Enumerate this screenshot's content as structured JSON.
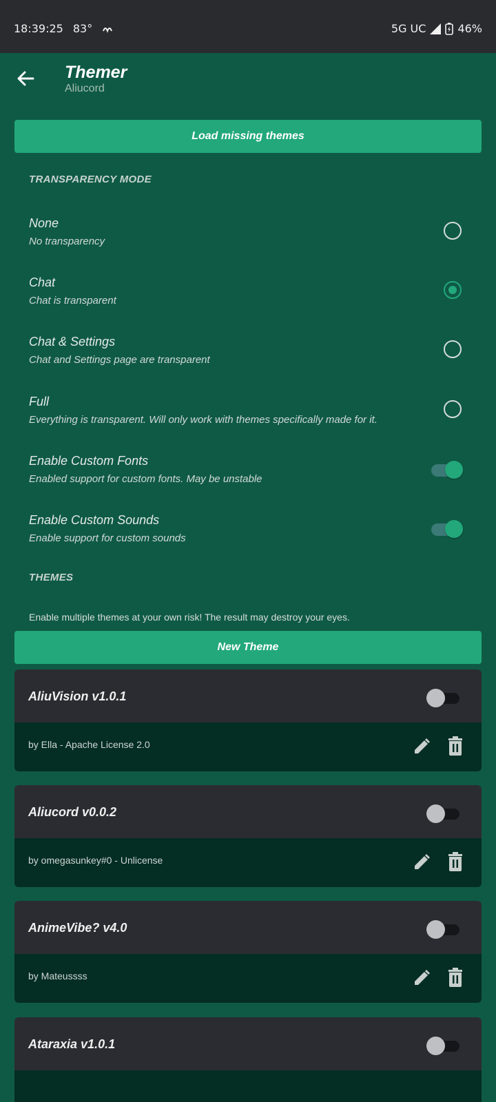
{
  "status": {
    "time": "18:39:25",
    "temp": "83°",
    "network": "5G UC",
    "battery": "46%"
  },
  "header": {
    "title": "Themer",
    "subtitle": "Aliucord"
  },
  "buttons": {
    "load_missing": "Load missing themes",
    "new_theme": "New Theme"
  },
  "transparency": {
    "section_title": "TRANSPARENCY MODE",
    "options": [
      {
        "title": "None",
        "desc": "No transparency",
        "selected": false
      },
      {
        "title": "Chat",
        "desc": "Chat is transparent",
        "selected": true
      },
      {
        "title": "Chat & Settings",
        "desc": "Chat and Settings page are transparent",
        "selected": false
      },
      {
        "title": "Full",
        "desc": "Everything is transparent. Will only work with themes specifically made for it.",
        "selected": false
      }
    ]
  },
  "toggles": [
    {
      "title": "Enable Custom Fonts",
      "desc": "Enabled support for custom fonts. May be unstable",
      "on": true
    },
    {
      "title": "Enable Custom Sounds",
      "desc": "Enable support for custom sounds",
      "on": true
    }
  ],
  "themes": {
    "section_title": "THEMES",
    "hint": "Enable multiple themes at your own risk! The result may destroy your eyes.",
    "items": [
      {
        "name": "AliuVision v1.0.1",
        "meta": "by Ella - Apache License 2.0",
        "enabled": false
      },
      {
        "name": "Aliucord v0.0.2",
        "meta": "by omegasunkey#0 - Unlicense",
        "enabled": false
      },
      {
        "name": "AnimeVibe? v4.0",
        "meta": "by Mateussss",
        "enabled": false
      },
      {
        "name": "Ataraxia v1.0.1",
        "meta": "",
        "enabled": false
      }
    ]
  },
  "colors": {
    "background": "#0f5a45",
    "accent": "#22a87a",
    "card_header": "#2b2c31",
    "card_body": "#042d24"
  }
}
